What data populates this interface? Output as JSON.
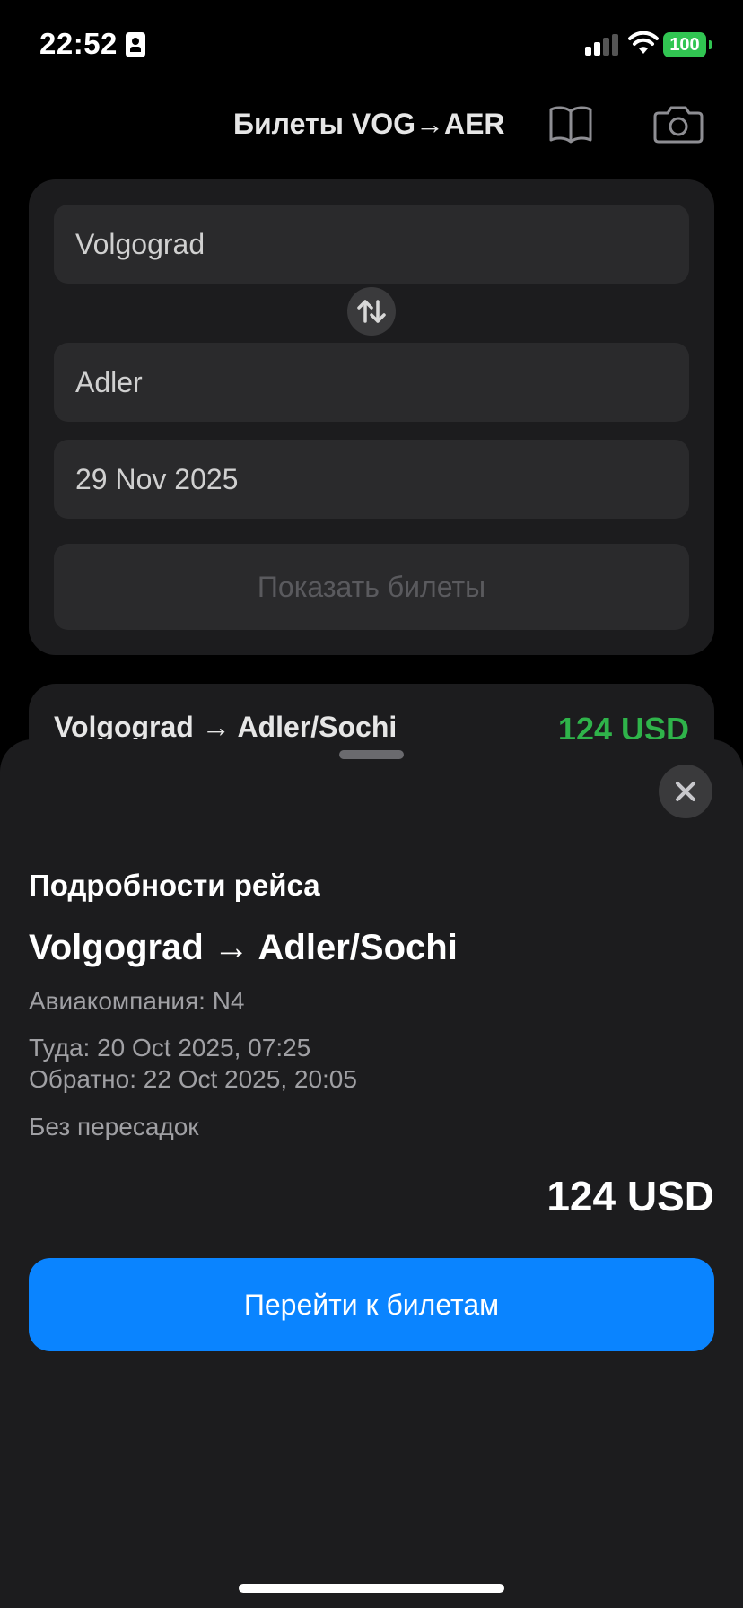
{
  "status_bar": {
    "time": "22:52",
    "battery": "100",
    "icons": [
      "id-card-icon",
      "cellular-signal-icon",
      "wifi-icon",
      "battery-icon"
    ]
  },
  "nav": {
    "title": "Билеты  VOG→AER",
    "icons": [
      "book-icon",
      "camera-icon"
    ]
  },
  "search": {
    "from": "Volgograd",
    "to": "Adler",
    "date": "29 Nov 2025",
    "show_button": "Показать билеты",
    "swap_icon": "swap-arrows-icon"
  },
  "result": {
    "route": "Volgograd → Adler/Sochi",
    "price": "124 USD",
    "price_color": "#2fb34a"
  },
  "sheet": {
    "heading": "Подробности рейса",
    "route": "Volgograd → Adler/Sochi",
    "airline": "Авиакомпания: N4",
    "depart": "Туда: 20 Oct 2025, 07:25",
    "return": "Обратно: 22 Oct 2025, 20:05",
    "stops": "Без пересадок",
    "price": "124 USD",
    "cta": "Перейти к билетам",
    "cta_color": "#0a84ff",
    "close_icon": "close-icon"
  }
}
